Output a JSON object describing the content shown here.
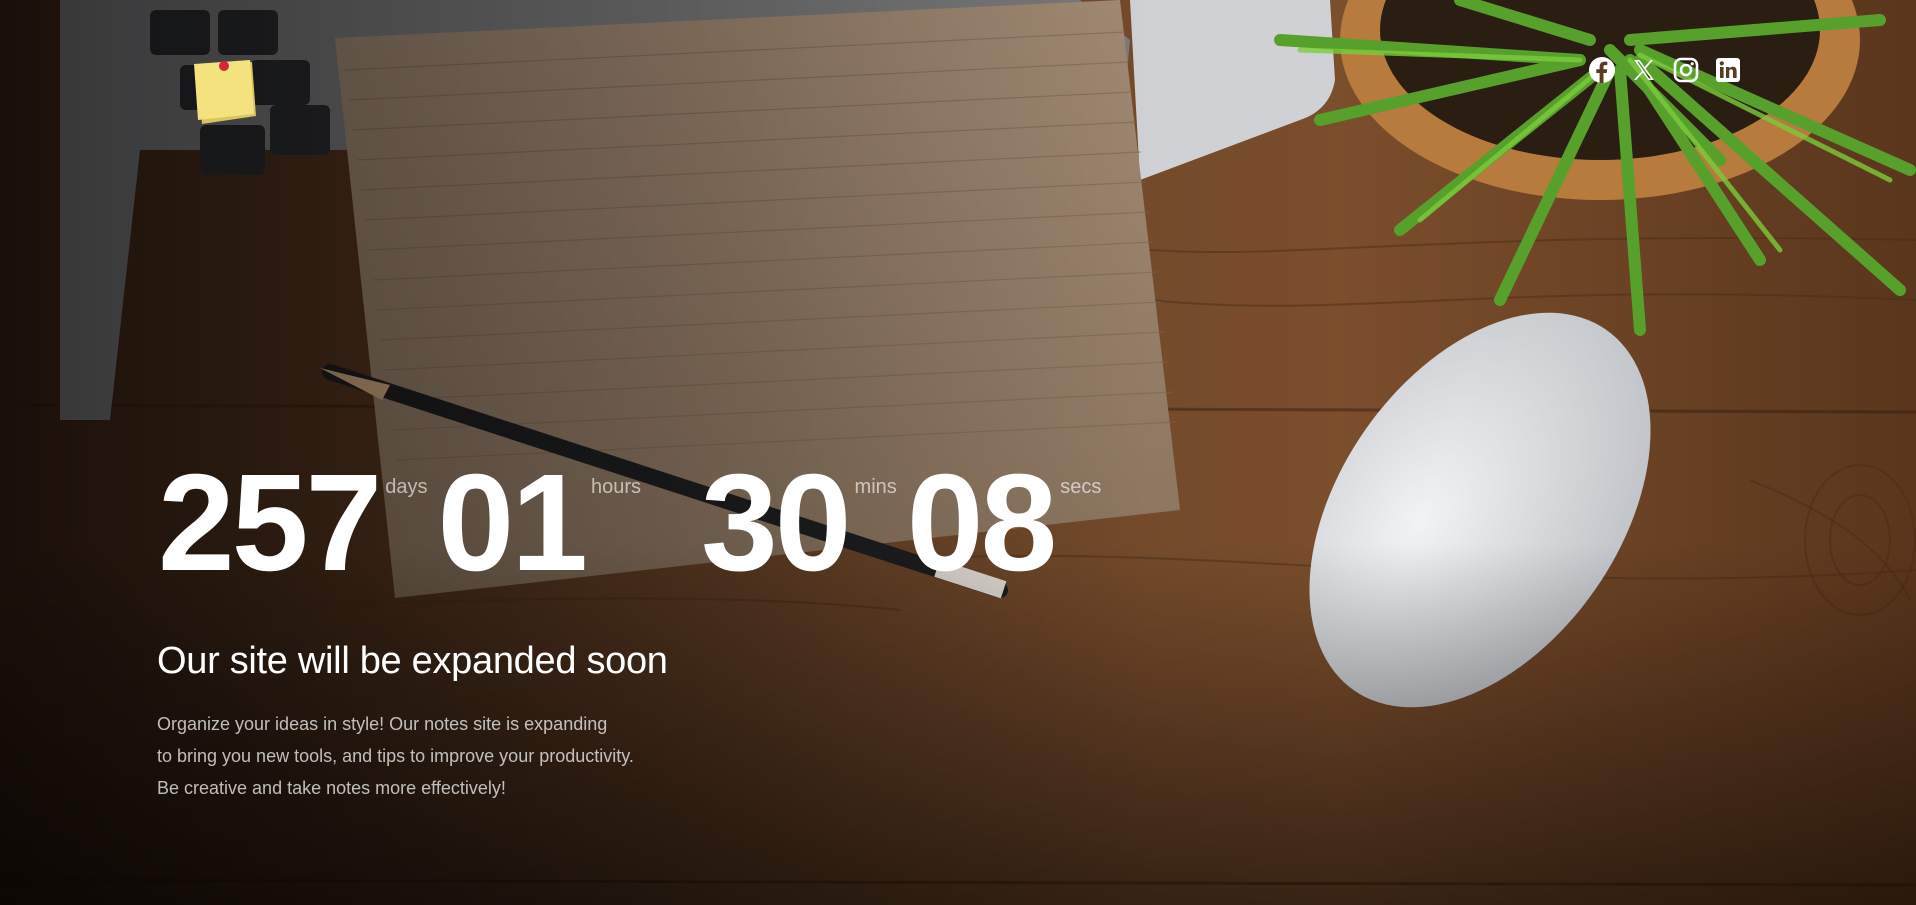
{
  "countdown": [
    {
      "value": "257",
      "unit": "days"
    },
    {
      "value": "01",
      "unit": "hours"
    },
    {
      "value": "30",
      "unit": "mins"
    },
    {
      "value": "08",
      "unit": "secs"
    }
  ],
  "headline": "Our site will be expanded soon",
  "description": [
    "Organize your ideas in style! Our notes site is expanding",
    "to bring you new tools, and tips to improve your productivity.",
    "Be creative and take notes more effectively!"
  ],
  "social": [
    "facebook-icon",
    "x-icon",
    "instagram-icon",
    "linkedin-icon"
  ],
  "colors": {
    "text": "#ffffff",
    "wood": "#6b4528",
    "note": "#f3e27e"
  }
}
